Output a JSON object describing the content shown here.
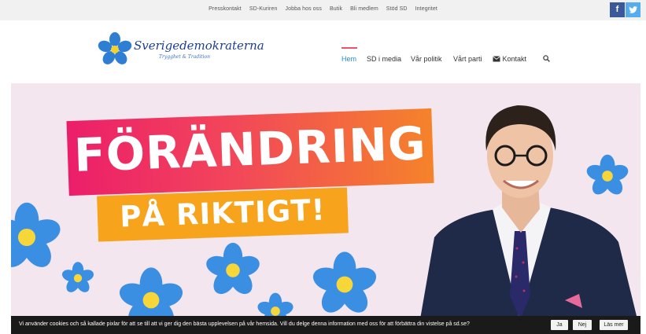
{
  "topbar": {
    "links": [
      "Presskontakt",
      "SD-Kuriren",
      "Jobba hos oss",
      "Butik",
      "Bli medlem",
      "Stöd SD",
      "Integritet"
    ],
    "facebook_glyph": "f",
    "twitter_glyph": "🐦",
    "facebook_icon": "facebook-icon",
    "twitter_icon": "twitter-icon"
  },
  "header": {
    "logo_text": "Sverigedemokraterna",
    "logo_tagline": "Trygghet & Tradition",
    "nav": {
      "home": "Hem",
      "media": "SD i media",
      "policy": "Vår politik",
      "party": "Vårt parti",
      "contact": "Kontakt",
      "search_icon": "search-icon",
      "mail_icon": "envelope-icon"
    },
    "accent_color": "#2a8bd5",
    "underline_color": "#f0516a"
  },
  "hero": {
    "headline": "FÖRÄNDRING",
    "subheadline": "PÅ RIKTIGT!",
    "background_color": "#f4e6ee",
    "headline_gradient": [
      "#ec1e6a",
      "#f5832a"
    ],
    "subheadline_color": "#f7a31b"
  },
  "cookie_bar": {
    "text": "Vi använder cookies och så kallade pixlar för att se till att vi ger dig den bästa upplevelsen på vår hemsida. Vill du delge denna information med oss för att förbättra din vistelse på sd.se?",
    "yes_label": "Ja",
    "no_label": "Nej",
    "more_label": "Läs mer"
  }
}
